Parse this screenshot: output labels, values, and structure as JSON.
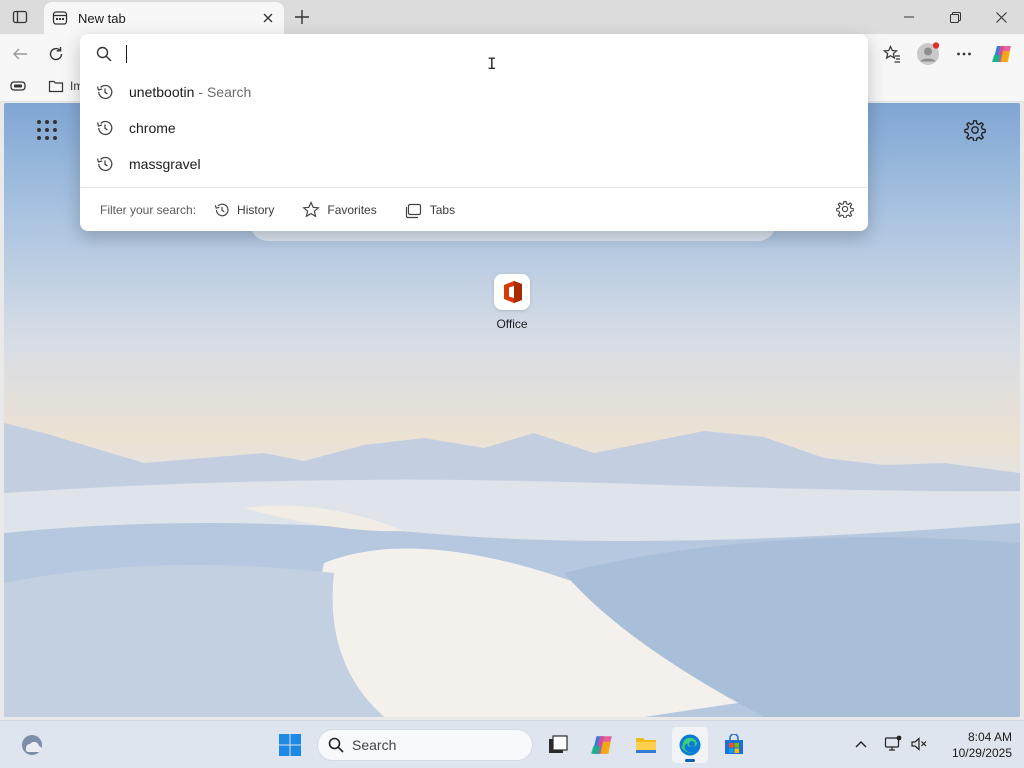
{
  "browser": {
    "tab_title": "New tab",
    "favorites_bar": {
      "item1_label": "Im"
    }
  },
  "omnibox": {
    "value": "",
    "suggestions": [
      {
        "text": "unetbootin",
        "suffix": "- Search",
        "icon": "history-icon"
      },
      {
        "text": "chrome",
        "suffix": "",
        "icon": "history-icon"
      },
      {
        "text": "massgravel",
        "suffix": "",
        "icon": "history-icon"
      }
    ],
    "filter_label": "Filter your search:",
    "filters": [
      {
        "label": "History",
        "icon": "history-icon"
      },
      {
        "label": "Favorites",
        "icon": "star-icon"
      },
      {
        "label": "Tabs",
        "icon": "tabs-icon"
      }
    ]
  },
  "new_tab_page": {
    "quick_links": [
      {
        "label": "Office",
        "icon": "office-icon"
      }
    ]
  },
  "taskbar": {
    "search_placeholder": "Search",
    "time": "8:04 AM",
    "date": "10/29/2025"
  },
  "colors": {
    "accent": "#0a5fb8",
    "office_red": "#d83b01",
    "edge_blue": "#0c7bd6",
    "edge_green": "#3ad17a"
  }
}
